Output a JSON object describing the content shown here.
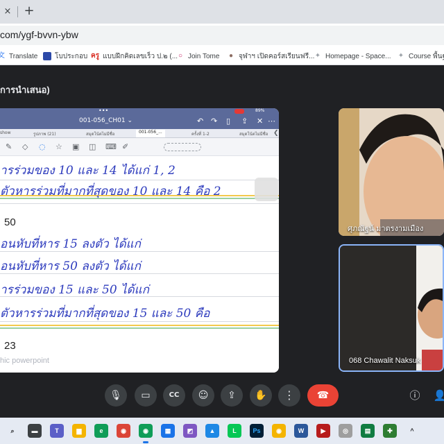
{
  "browser": {
    "tab_close_glyph": "×",
    "new_tab_glyph": "+",
    "url": "com/ygf-bvvn-ybw"
  },
  "bookmarks": [
    {
      "label": "Translate",
      "icon": "translate-icon",
      "glyph": "文",
      "color": "#4285f4"
    },
    {
      "label": "โบประกอบ",
      "icon": "thai-flag-icon",
      "glyph": "",
      "color": "#2d4aa8"
    },
    {
      "label": "แบบฝึกคิดเลขเร็ว ป.๒ (...",
      "icon": "kru-icon",
      "glyph": "ครู",
      "color": "#d93025"
    },
    {
      "label": "Join Tome",
      "icon": "tome-icon",
      "glyph": "○",
      "color": "#c2185b"
    },
    {
      "label": "จุฬาฯ เปิดคอร์สเรียนฟรี...",
      "icon": "chula-icon",
      "glyph": "●",
      "color": "#8d6e63"
    },
    {
      "label": "Homepage - Space...",
      "icon": "space-icon",
      "glyph": "✦",
      "color": "#9aa0a6"
    },
    {
      "label": "Course พื้นฐาน",
      "icon": "course-icon",
      "glyph": "✦",
      "color": "#9aa0a6"
    }
  ],
  "meeting": {
    "title": "การนำเสนอ)"
  },
  "presentation": {
    "status_dots": "•••",
    "battery": "89%",
    "doc_title": "001-056_CH01",
    "doc_title_caret": "⌄",
    "tabs": [
      {
        "label": "show",
        "active": false
      },
      {
        "label": "รูปภาพ (21)",
        "active": false
      },
      {
        "label": "สมุดโน้ตไม่มีชื่อ",
        "active": false
      },
      {
        "label": "001-056_...",
        "active": true
      },
      {
        "label": "ครั้งที่ 1-2",
        "active": false
      },
      {
        "label": "สมุดโน้ตไม่มีชื่อ",
        "active": false
      }
    ],
    "handwriting": [
      "ารร่วมของ 10 และ 14 ได้แก่ 1, 2",
      "ตัวหารร่วมที่มากที่สุดของ 10 และ 14 คือ 2",
      "อนหับที่หาร 15 ลงตัว ได้แก่",
      "อนหับที่หาร 50 ลงตัว ได้แก่",
      "ารร่วมของ 15 และ 50 ได้แก่",
      "ตัวหารร่วมที่มากที่สุดของ 15 และ 50 คือ"
    ],
    "question_numbers": [
      "50",
      "23"
    ],
    "watermark": "hic powerpoint"
  },
  "participants": [
    {
      "name": "ศุภณัฐน์ มาตรงามเมือง",
      "speaking": false
    },
    {
      "name": "068 Chawalit Naksuk",
      "speaking": true
    }
  ],
  "controls": [
    {
      "name": "microphone-button",
      "glyph": "🎙"
    },
    {
      "name": "camera-button",
      "glyph": "▭"
    },
    {
      "name": "captions-button",
      "glyph": "CC"
    },
    {
      "name": "emoji-button",
      "glyph": "☺"
    },
    {
      "name": "present-button",
      "glyph": "⇪"
    },
    {
      "name": "raise-hand-button",
      "glyph": "✋"
    },
    {
      "name": "more-options-button",
      "glyph": "⋮"
    }
  ],
  "end_call_glyph": "☎",
  "side_controls": {
    "info_glyph": "ⓘ",
    "people_glyph": "👤"
  },
  "taskbar": [
    {
      "name": "search-icon",
      "glyph": "⌕",
      "color": "#e5eaf3",
      "text": "#202124"
    },
    {
      "name": "file-explorer-icon",
      "glyph": "▬",
      "color": "#3c4043",
      "text": "#ffffff"
    },
    {
      "name": "teams-icon",
      "glyph": "T",
      "color": "#5b5fc7",
      "text": "#ffffff"
    },
    {
      "name": "folder-icon",
      "glyph": "▆",
      "color": "#f4b400",
      "text": "#ffffff"
    },
    {
      "name": "edge-icon",
      "glyph": "e",
      "color": "#0f9d58",
      "text": "#ffffff"
    },
    {
      "name": "chrome-icon",
      "glyph": "◉",
      "color": "#db4437",
      "text": "#ffffff"
    },
    {
      "name": "chrome-profile-icon",
      "glyph": "◉",
      "color": "#0f9d58",
      "text": "#ffffff"
    },
    {
      "name": "store-icon",
      "glyph": "▦",
      "color": "#1a73e8",
      "text": "#ffffff"
    },
    {
      "name": "sticky-icon",
      "glyph": "◩",
      "color": "#7e57c2",
      "text": "#ffffff"
    },
    {
      "name": "photos-icon",
      "glyph": "▲",
      "color": "#1e88e5",
      "text": "#ffffff"
    },
    {
      "name": "line-icon",
      "glyph": "L",
      "color": "#06c755",
      "text": "#ffffff"
    },
    {
      "name": "photoshop-icon",
      "glyph": "Ps",
      "color": "#001e36",
      "text": "#31a8ff"
    },
    {
      "name": "chrome-alt-icon",
      "glyph": "◉",
      "color": "#f4b400",
      "text": "#ffffff"
    },
    {
      "name": "word-icon",
      "glyph": "W",
      "color": "#2b579a",
      "text": "#ffffff"
    },
    {
      "name": "media-icon",
      "glyph": "▶",
      "color": "#b71c1c",
      "text": "#ffffff"
    },
    {
      "name": "wifi-icon",
      "glyph": "◎",
      "color": "#9e9e9e",
      "text": "#ffffff"
    },
    {
      "name": "excel-icon",
      "glyph": "▤",
      "color": "#107c41",
      "text": "#ffffff"
    },
    {
      "name": "app-green-icon",
      "glyph": "✚",
      "color": "#2e7d32",
      "text": "#ffffff"
    },
    {
      "name": "chevron-up-icon",
      "glyph": "^",
      "color": "#e5eaf3",
      "text": "#202124"
    }
  ]
}
